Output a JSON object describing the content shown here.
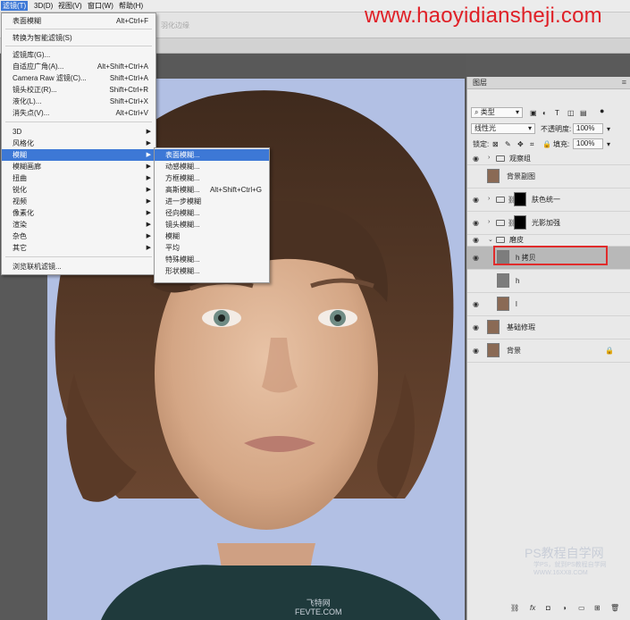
{
  "watermark": "www.haoyidiansheji.com",
  "menubar": {
    "items": [
      "滤镜(T)",
      "3D(D)",
      "视图(V)",
      "窗口(W)",
      "帮助(H)"
    ]
  },
  "options_bar": {
    "ghost_text": "羽化边缘"
  },
  "filter_menu": {
    "items": [
      {
        "label": "表面模糊",
        "shortcut": "Alt+Ctrl+F"
      },
      {
        "label": "转换为智能滤镜(S)",
        "shortcut": ""
      },
      {
        "label": "滤镜库(G)...",
        "shortcut": ""
      },
      {
        "label": "自适应广角(A)...",
        "shortcut": "Alt+Shift+Ctrl+A"
      },
      {
        "label": "Camera Raw 滤镜(C)...",
        "shortcut": "Shift+Ctrl+A"
      },
      {
        "label": "镜头校正(R)...",
        "shortcut": "Shift+Ctrl+R"
      },
      {
        "label": "液化(L)...",
        "shortcut": "Shift+Ctrl+X"
      },
      {
        "label": "消失点(V)...",
        "shortcut": "Alt+Ctrl+V"
      },
      {
        "label": "3D",
        "shortcut": ""
      },
      {
        "label": "风格化",
        "shortcut": ""
      },
      {
        "label": "模糊",
        "shortcut": ""
      },
      {
        "label": "模糊画廊",
        "shortcut": ""
      },
      {
        "label": "扭曲",
        "shortcut": ""
      },
      {
        "label": "锐化",
        "shortcut": ""
      },
      {
        "label": "视频",
        "shortcut": ""
      },
      {
        "label": "像素化",
        "shortcut": ""
      },
      {
        "label": "渲染",
        "shortcut": ""
      },
      {
        "label": "杂色",
        "shortcut": ""
      },
      {
        "label": "其它",
        "shortcut": ""
      },
      {
        "label": "浏览联机滤镜...",
        "shortcut": ""
      }
    ]
  },
  "blur_submenu": {
    "items": [
      {
        "label": "表面模糊...",
        "shortcut": ""
      },
      {
        "label": "动感模糊...",
        "shortcut": ""
      },
      {
        "label": "方框模糊...",
        "shortcut": ""
      },
      {
        "label": "高斯模糊...",
        "shortcut": "Alt+Shift+Ctrl+G"
      },
      {
        "label": "进一步模糊",
        "shortcut": ""
      },
      {
        "label": "径向模糊...",
        "shortcut": ""
      },
      {
        "label": "镜头模糊...",
        "shortcut": ""
      },
      {
        "label": "模糊",
        "shortcut": ""
      },
      {
        "label": "平均",
        "shortcut": ""
      },
      {
        "label": "特殊模糊...",
        "shortcut": ""
      },
      {
        "label": "形状模糊...",
        "shortcut": ""
      }
    ]
  },
  "layers_panel": {
    "title": "图层",
    "filter_kind": "类型",
    "blend_mode": "线性光",
    "opacity_label": "不透明度:",
    "opacity_value": "100%",
    "lock_label": "锁定:",
    "fill_label": "填充:",
    "fill_value": "100%",
    "layers": [
      {
        "name": "观察组"
      },
      {
        "name": "背景副图"
      },
      {
        "name": "肤色统一"
      },
      {
        "name": "光影加强"
      },
      {
        "name": "磨皮"
      },
      {
        "name": "h 拷贝"
      },
      {
        "name": "h"
      },
      {
        "name": "l"
      },
      {
        "name": "基础修瑕"
      },
      {
        "name": "背景"
      }
    ],
    "footer_fx": "fx"
  },
  "canvas_brand": {
    "line1": "飞特网",
    "line2": "FEVTE.COM"
  },
  "ps_mark": {
    "title": "PS教程自学网",
    "sub1": "学PS，就到PS教程自学网",
    "sub2": "WWW.16XX8.COM"
  },
  "colors": {
    "menu_highlight": "#3d78d6",
    "watermark": "#e01f26",
    "selection_outline": "#e02b2b",
    "panel_selected": "#b8b8b8"
  }
}
